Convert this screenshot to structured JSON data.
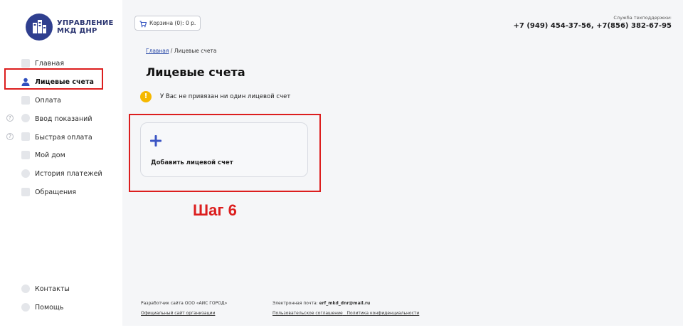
{
  "brand": {
    "line1": "УПРАВЛЕНИЕ",
    "line2": "МКД ДНР"
  },
  "sidebar": {
    "items": [
      {
        "label": "Главная",
        "icon": "home-icon",
        "help": false
      },
      {
        "label": "Лицевые счета",
        "icon": "user-icon",
        "help": false,
        "active": true
      },
      {
        "label": "Оплата",
        "icon": "card-icon",
        "help": false
      },
      {
        "label": "Ввод показаний",
        "icon": "meter-icon",
        "help": true
      },
      {
        "label": "Быстрая оплата",
        "icon": "wallet-icon",
        "help": true
      },
      {
        "label": "Мой дом",
        "icon": "building-icon",
        "help": false
      },
      {
        "label": "История платежей",
        "icon": "history-icon",
        "help": false
      },
      {
        "label": "Обращения",
        "icon": "message-icon",
        "help": false
      }
    ],
    "bottom_items": [
      {
        "label": "Контакты",
        "icon": "location-icon"
      },
      {
        "label": "Помощь",
        "icon": "help-icon"
      }
    ],
    "help_mark": "?"
  },
  "header": {
    "cart_label": "Корзина (0): 0 р.",
    "support_label": "Служба техподдержки:",
    "support_phones": "+7 (949) 454-37-56, +7(856) 382-67-95"
  },
  "breadcrumb": {
    "home": "Главная",
    "separator": " / ",
    "current": "Лицевые счета"
  },
  "page_title": "Лицевые счета",
  "notice": {
    "icon_text": "!",
    "text": "У Вас не привязан ни один лицевой счет"
  },
  "add_card": {
    "label": "Добавить лицевой счет"
  },
  "step_label": "Шаг 6",
  "footer": {
    "developer": "Разработчик сайта ООО «АИС ГОРОД»",
    "official_site": "Официальный сайт организации",
    "email_label": "Электронная почта:",
    "email": "erf_mkd_dnr@mail.ru",
    "user_agreement": "Пользовательское соглашение",
    "privacy_policy": "Политика конфиденциальности"
  },
  "colors": {
    "accent": "#2f3f8f",
    "highlight": "#dc1e1e",
    "warning": "#f5b800",
    "plus": "#3b55c4"
  }
}
